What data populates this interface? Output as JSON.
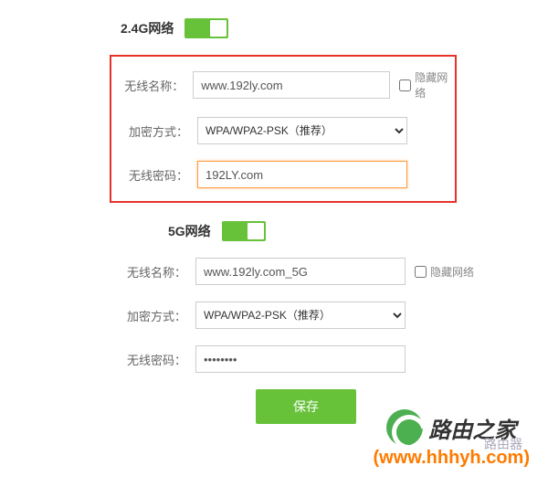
{
  "section24": {
    "title": "2.4G网络",
    "ssid_label": "无线名称：",
    "ssid_value": "www.192ly.com",
    "hide_label": "隐藏网络",
    "enc_label": "加密方式：",
    "enc_value": "WPA/WPA2-PSK（推荐）",
    "pwd_label": "无线密码：",
    "pwd_value": "192LY.com"
  },
  "section5": {
    "title": "5G网络",
    "ssid_label": "无线名称：",
    "ssid_value": "www.192ly.com_5G",
    "hide_label": "隐藏网络",
    "enc_label": "加密方式：",
    "enc_value": "WPA/WPA2-PSK（推荐）",
    "pwd_label": "无线密码：",
    "pwd_value": "••••••••"
  },
  "save_label": "保存",
  "watermark": {
    "brand": "路由之家",
    "sub": "路由器",
    "url": "(www.hhhyh.com)"
  }
}
